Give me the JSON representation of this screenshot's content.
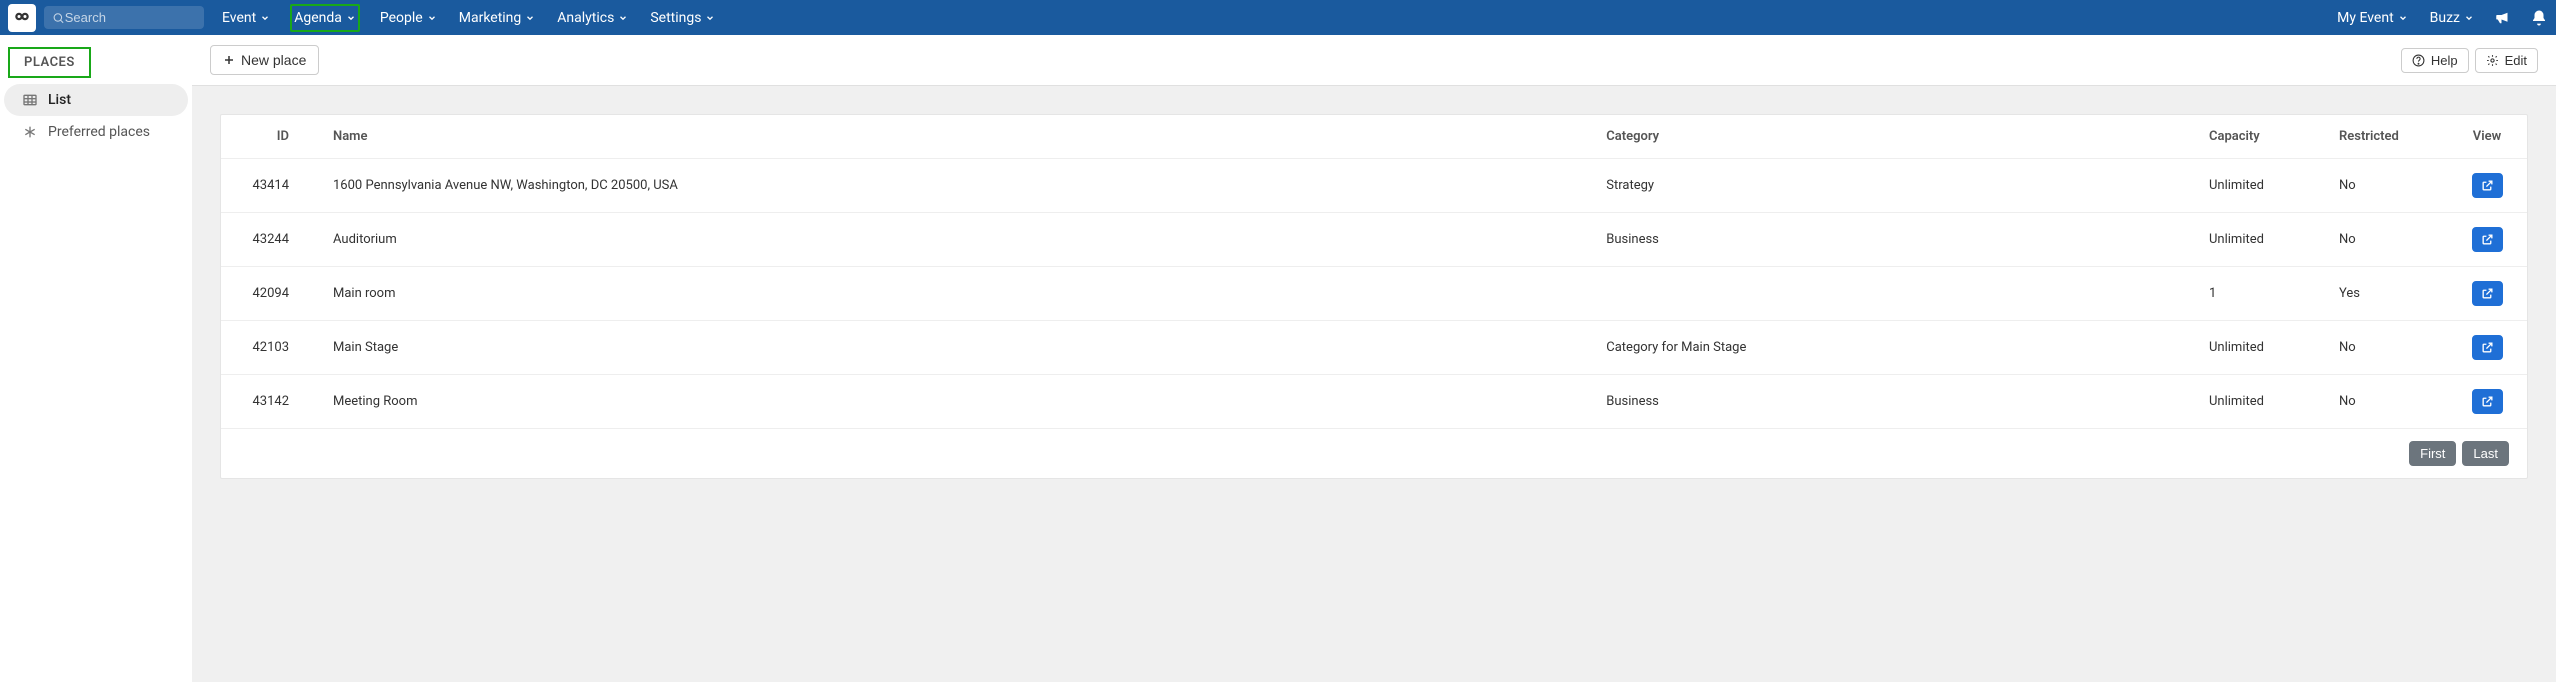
{
  "topbar": {
    "search_placeholder": "Search",
    "nav": [
      "Event",
      "Agenda",
      "People",
      "Marketing",
      "Analytics",
      "Settings"
    ],
    "highlighted_nav_index": 1,
    "right": {
      "my_event": "My Event",
      "buzz": "Buzz"
    }
  },
  "sidebar": {
    "title": "PLACES",
    "items": [
      {
        "label": "List",
        "active": true,
        "icon": "grid-icon"
      },
      {
        "label": "Preferred places",
        "active": false,
        "icon": "asterisk-icon"
      }
    ]
  },
  "toolbar": {
    "new_place": "New place",
    "help": "Help",
    "edit": "Edit"
  },
  "table": {
    "headers": {
      "id": "ID",
      "name": "Name",
      "category": "Category",
      "capacity": "Capacity",
      "restricted": "Restricted",
      "view": "View"
    },
    "rows": [
      {
        "id": "43414",
        "name": "1600 Pennsylvania Avenue NW, Washington, DC 20500, USA",
        "category": "Strategy",
        "capacity": "Unlimited",
        "restricted": "No"
      },
      {
        "id": "43244",
        "name": "Auditorium",
        "category": "Business",
        "capacity": "Unlimited",
        "restricted": "No"
      },
      {
        "id": "42094",
        "name": "Main room",
        "category": "",
        "capacity": "1",
        "restricted": "Yes"
      },
      {
        "id": "42103",
        "name": "Main Stage",
        "category": "Category for Main Stage",
        "capacity": "Unlimited",
        "restricted": "No"
      },
      {
        "id": "43142",
        "name": "Meeting Room",
        "category": "Business",
        "capacity": "Unlimited",
        "restricted": "No"
      }
    ]
  },
  "pager": {
    "first": "First",
    "last": "Last"
  }
}
